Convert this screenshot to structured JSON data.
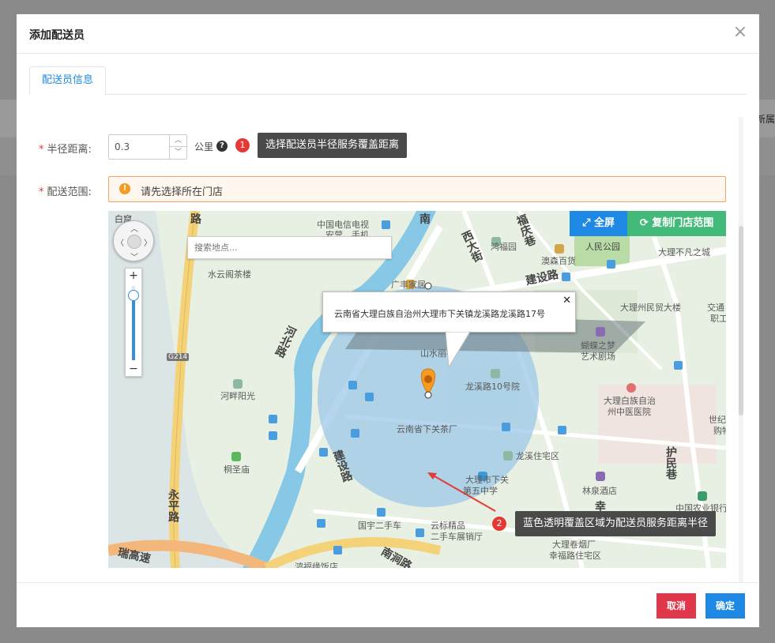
{
  "modal": {
    "title": "添加配送员",
    "close_icon": "close-icon"
  },
  "background": {
    "right_text": "新属"
  },
  "tabs": [
    {
      "label": "配送员信息"
    }
  ],
  "form": {
    "radius": {
      "label": "半径距离:",
      "value": "0.3",
      "unit": "公里"
    },
    "range": {
      "label": "配送范围:"
    },
    "alert": "请先选择所在门店"
  },
  "callouts": [
    {
      "num": "1",
      "text": "选择配送员半径服务覆盖距离"
    },
    {
      "num": "2",
      "text": "蓝色透明覆盖区域为配送员服务距离半径"
    }
  ],
  "map": {
    "search_placeholder": "搜索地点...",
    "fullscreen_label": "全屏",
    "copy_range_label": "复制门店范围",
    "info_text": "云南省大理白族自治州大理市下关镇龙溪路龙溪路17号",
    "info_close": "✕",
    "labels": {
      "bai_tan": "白窟",
      "telecom": "中国电信电视",
      "telecom2": "安营…手机",
      "shuiyun": "水云阁茶楼",
      "guangfeng": "广丰家居",
      "shanshui": "山水丽都",
      "hongfu": "鸿福园",
      "aosen": "澳森百货",
      "renmin_park": "人民公园",
      "dali_minmao": "大理州民贸大楼",
      "jiaotong": "交通",
      "zhigong": "职工",
      "dali_bufan": "大理不凡之城",
      "hudie": "蝴蝶之梦",
      "yishu": "艺术剧场",
      "longxi10": "龙溪路10号院",
      "hepan": "河畔阳光",
      "tea_factory": "云南省下关茶厂",
      "hospital1": "大理白族自治",
      "hospital2": "州中医医院",
      "shiji": "世纪",
      "gouwu": "购物",
      "longxi_zhai": "龙溪住宅区",
      "xiaguan5": "大理市下关",
      "xiaguan5b": "第五中学",
      "linquan": "林泉酒店",
      "qiaoshengmiao": "桐圣庙",
      "guoyu": "国宇二手车",
      "yunbiao": "云标精品",
      "yunbiao2": "二手车展销厅",
      "abc_bank": "中国农业银行",
      "juanyan": "大理卷烟厂",
      "xingfu": "幸福路住宅区",
      "hongfu_hotel": "鸿福缘饭店"
    },
    "roads": {
      "yongping": "永平路",
      "jianshe1": "建设路",
      "jianshe2": "建设路",
      "xi_da": "西大街",
      "fuqing": "福庆巷",
      "hubei": "河北路",
      "nan_jian": "南涧路",
      "huimin": "护民巷",
      "xing": "幸",
      "g214": "G214",
      "gaosu": "瑞高速",
      "lu_top": "路",
      "nan_top": "南"
    }
  },
  "footer": {
    "cancel_label": "取消",
    "ok_label": "确定"
  },
  "colors": {
    "primary": "#1e88e5",
    "danger": "#e0374a",
    "success": "#43b97a",
    "coverage": "#9cc8e8"
  }
}
